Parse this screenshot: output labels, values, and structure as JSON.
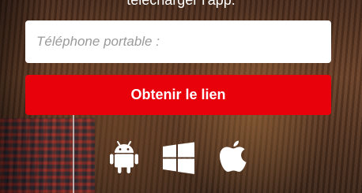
{
  "header": {
    "headline": "télécharger l'app."
  },
  "form": {
    "phone_placeholder": "Téléphone portable :",
    "phone_value": "",
    "submit_label": "Obtenir le lien"
  },
  "platforms": [
    {
      "name": "android-icon"
    },
    {
      "name": "windows-icon"
    },
    {
      "name": "apple-icon"
    }
  ],
  "colors": {
    "button": "#e8000b",
    "input_bg": "#ffffff",
    "text_light": "#ffffff",
    "placeholder": "#9a9a9a"
  }
}
